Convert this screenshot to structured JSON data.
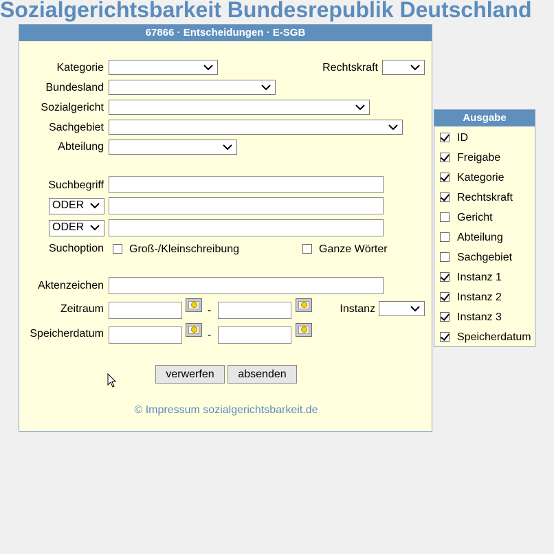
{
  "site_title": "Sozialgerichtsbarkeit Bundesrepublik Deutschland",
  "panel": {
    "title": "67866 · Entscheidungen · E-SGB"
  },
  "form": {
    "kategorie_label": "Kategorie",
    "rechtskraft_label": "Rechtskraft",
    "bundesland_label": "Bundesland",
    "sozialgericht_label": "Sozialgericht",
    "sachgebiet_label": "Sachgebiet",
    "abteilung_label": "Abteilung",
    "suchbegriff_label": "Suchbegriff",
    "operator_1": "ODER",
    "operator_2": "ODER",
    "suchoption_label": "Suchoption",
    "option_case": "Groß-/Kleinschreibung",
    "option_words": "Ganze Wörter",
    "aktenzeichen_label": "Aktenzeichen",
    "zeitraum_label": "Zeitraum",
    "instanz_label": "Instanz",
    "speicherdatum_label": "Speicherdatum",
    "dash": "-",
    "reset_button": "verwerfen",
    "submit_button": "absenden"
  },
  "impressum": "© Impressum sozialgerichtsbarkeit.de",
  "output": {
    "title": "Ausgabe",
    "items": [
      {
        "label": "ID",
        "checked": true
      },
      {
        "label": "Freigabe",
        "checked": true
      },
      {
        "label": "Kategorie",
        "checked": true
      },
      {
        "label": "Rechtskraft",
        "checked": true
      },
      {
        "label": "Gericht",
        "checked": false
      },
      {
        "label": "Abteilung",
        "checked": false
      },
      {
        "label": "Sachgebiet",
        "checked": false
      },
      {
        "label": "Instanz 1",
        "checked": true
      },
      {
        "label": "Instanz 2",
        "checked": true
      },
      {
        "label": "Instanz 3",
        "checked": true
      },
      {
        "label": "Speicherdatum",
        "checked": true
      }
    ]
  },
  "colors": {
    "accent": "#5f8fbd",
    "panel_bg": "#ffffdd",
    "title_text": "#5b8cbc"
  }
}
